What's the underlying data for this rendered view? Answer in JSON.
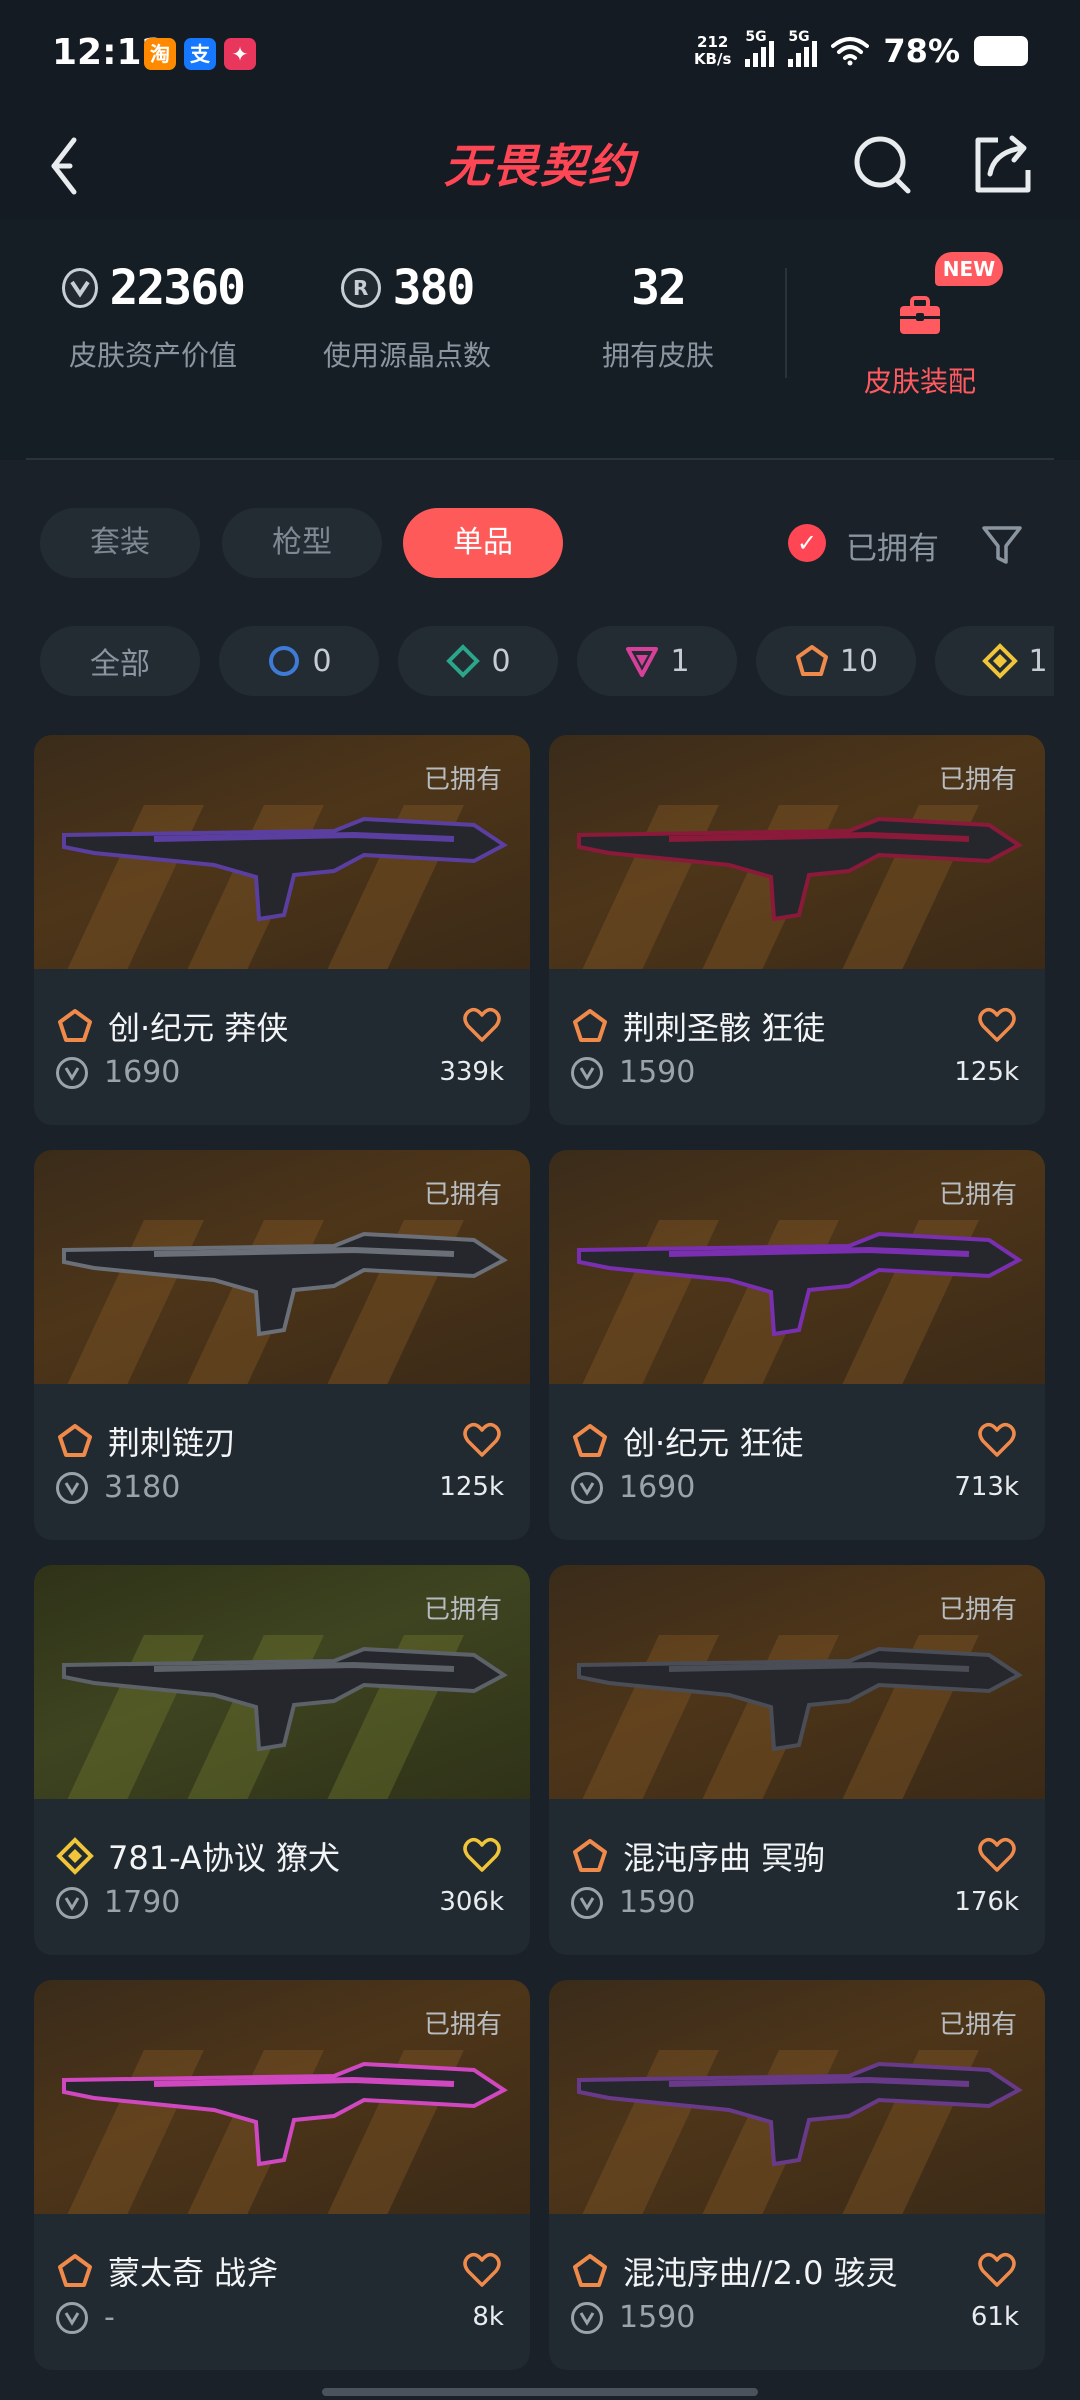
{
  "status_bar": {
    "time": "12:12",
    "apps": [
      {
        "icon": "taobao-app-icon",
        "glyph": "淘",
        "color": "#ff8a00"
      },
      {
        "icon": "alipay-app-icon",
        "glyph": "支",
        "color": "#1677ff"
      },
      {
        "icon": "game-app-icon",
        "glyph": "✦",
        "color": "#e8365d"
      }
    ],
    "net_speed_value": "212",
    "net_speed_unit": "KB/s",
    "signal_1": "5G",
    "signal_2": "5G",
    "battery_pct": "78%"
  },
  "header": {
    "title": "无畏契约"
  },
  "stats": {
    "asset_value": "22360",
    "asset_label": "皮肤资产价值",
    "radianite_points": "380",
    "radianite_label": "使用源晶点数",
    "skins_owned": "32",
    "skins_owned_label": "拥有皮肤",
    "equip_label": "皮肤装配",
    "new_badge": "NEW"
  },
  "tabs": [
    {
      "label": "套装",
      "active": false
    },
    {
      "label": "枪型",
      "active": false
    },
    {
      "label": "单品",
      "active": true
    }
  ],
  "owned_filter_label": "已拥有",
  "tier_chips": [
    {
      "label": "全部",
      "icon": null,
      "count": ""
    },
    {
      "icon": "select-tier-icon",
      "count": "0",
      "color": "#3d7bd6"
    },
    {
      "icon": "deluxe-tier-icon",
      "count": "0",
      "color": "#2aa68a"
    },
    {
      "icon": "premium-tier-icon",
      "count": "1",
      "color": "#d6409a"
    },
    {
      "icon": "ultra-tier-icon",
      "count": "10",
      "color": "#f08a4b"
    },
    {
      "icon": "exclusive-tier-icon",
      "count": "1",
      "color": "#f0c53a"
    }
  ],
  "cards": [
    {
      "name": "创·纪元 莽侠",
      "price": "1690",
      "likes": "339k",
      "owned": "已拥有",
      "tier_color": "#f08a4b",
      "heart_color": "#f08a4b",
      "theme": "bronze"
    },
    {
      "name": "荆刺圣骸 狂徒",
      "price": "1590",
      "likes": "125k",
      "owned": "已拥有",
      "tier_color": "#f08a4b",
      "heart_color": "#f08a4b",
      "theme": "bronze"
    },
    {
      "name": "荆刺链刃",
      "price": "3180",
      "likes": "125k",
      "owned": "已拥有",
      "tier_color": "#f08a4b",
      "heart_color": "#f08a4b",
      "theme": "bronze"
    },
    {
      "name": "创·纪元 狂徒",
      "price": "1690",
      "likes": "713k",
      "owned": "已拥有",
      "tier_color": "#f08a4b",
      "heart_color": "#f08a4b",
      "theme": "bronze"
    },
    {
      "name": "781-A协议 獠犬",
      "price": "1790",
      "likes": "306k",
      "owned": "已拥有",
      "tier_color": "#f0c53a",
      "heart_color": "#f0c53a",
      "theme": "green"
    },
    {
      "name": "混沌序曲 冥驹",
      "price": "1590",
      "likes": "176k",
      "owned": "已拥有",
      "tier_color": "#f08a4b",
      "heart_color": "#f08a4b",
      "theme": "bronze"
    },
    {
      "name": "蒙太奇 战斧",
      "price": "-",
      "likes": "8k",
      "owned": "已拥有",
      "tier_color": "#f08a4b",
      "heart_color": "#f08a4b",
      "theme": "bronze"
    },
    {
      "name": "混沌序曲//2.0 骇灵",
      "price": "1590",
      "likes": "61k",
      "owned": "已拥有",
      "tier_color": "#f08a4b",
      "heart_color": "#f08a4b",
      "theme": "bronze"
    }
  ]
}
